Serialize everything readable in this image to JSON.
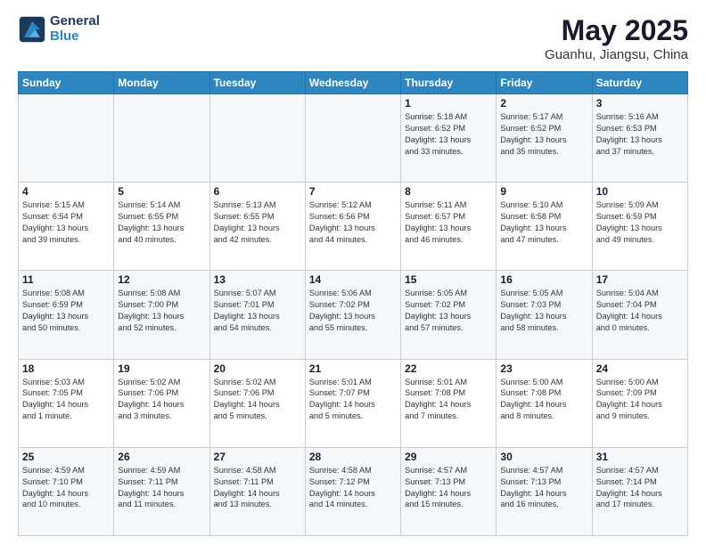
{
  "logo": {
    "line1": "General",
    "line2": "Blue"
  },
  "title": "May 2025",
  "subtitle": "Guanhu, Jiangsu, China",
  "weekdays": [
    "Sunday",
    "Monday",
    "Tuesday",
    "Wednesday",
    "Thursday",
    "Friday",
    "Saturday"
  ],
  "weeks": [
    [
      {
        "day": "",
        "info": ""
      },
      {
        "day": "",
        "info": ""
      },
      {
        "day": "",
        "info": ""
      },
      {
        "day": "",
        "info": ""
      },
      {
        "day": "1",
        "info": "Sunrise: 5:18 AM\nSunset: 6:52 PM\nDaylight: 13 hours\nand 33 minutes."
      },
      {
        "day": "2",
        "info": "Sunrise: 5:17 AM\nSunset: 6:52 PM\nDaylight: 13 hours\nand 35 minutes."
      },
      {
        "day": "3",
        "info": "Sunrise: 5:16 AM\nSunset: 6:53 PM\nDaylight: 13 hours\nand 37 minutes."
      }
    ],
    [
      {
        "day": "4",
        "info": "Sunrise: 5:15 AM\nSunset: 6:54 PM\nDaylight: 13 hours\nand 39 minutes."
      },
      {
        "day": "5",
        "info": "Sunrise: 5:14 AM\nSunset: 6:55 PM\nDaylight: 13 hours\nand 40 minutes."
      },
      {
        "day": "6",
        "info": "Sunrise: 5:13 AM\nSunset: 6:55 PM\nDaylight: 13 hours\nand 42 minutes."
      },
      {
        "day": "7",
        "info": "Sunrise: 5:12 AM\nSunset: 6:56 PM\nDaylight: 13 hours\nand 44 minutes."
      },
      {
        "day": "8",
        "info": "Sunrise: 5:11 AM\nSunset: 6:57 PM\nDaylight: 13 hours\nand 46 minutes."
      },
      {
        "day": "9",
        "info": "Sunrise: 5:10 AM\nSunset: 6:58 PM\nDaylight: 13 hours\nand 47 minutes."
      },
      {
        "day": "10",
        "info": "Sunrise: 5:09 AM\nSunset: 6:59 PM\nDaylight: 13 hours\nand 49 minutes."
      }
    ],
    [
      {
        "day": "11",
        "info": "Sunrise: 5:08 AM\nSunset: 6:59 PM\nDaylight: 13 hours\nand 50 minutes."
      },
      {
        "day": "12",
        "info": "Sunrise: 5:08 AM\nSunset: 7:00 PM\nDaylight: 13 hours\nand 52 minutes."
      },
      {
        "day": "13",
        "info": "Sunrise: 5:07 AM\nSunset: 7:01 PM\nDaylight: 13 hours\nand 54 minutes."
      },
      {
        "day": "14",
        "info": "Sunrise: 5:06 AM\nSunset: 7:02 PM\nDaylight: 13 hours\nand 55 minutes."
      },
      {
        "day": "15",
        "info": "Sunrise: 5:05 AM\nSunset: 7:02 PM\nDaylight: 13 hours\nand 57 minutes."
      },
      {
        "day": "16",
        "info": "Sunrise: 5:05 AM\nSunset: 7:03 PM\nDaylight: 13 hours\nand 58 minutes."
      },
      {
        "day": "17",
        "info": "Sunrise: 5:04 AM\nSunset: 7:04 PM\nDaylight: 14 hours\nand 0 minutes."
      }
    ],
    [
      {
        "day": "18",
        "info": "Sunrise: 5:03 AM\nSunset: 7:05 PM\nDaylight: 14 hours\nand 1 minute."
      },
      {
        "day": "19",
        "info": "Sunrise: 5:02 AM\nSunset: 7:06 PM\nDaylight: 14 hours\nand 3 minutes."
      },
      {
        "day": "20",
        "info": "Sunrise: 5:02 AM\nSunset: 7:06 PM\nDaylight: 14 hours\nand 5 minutes."
      },
      {
        "day": "21",
        "info": "Sunrise: 5:01 AM\nSunset: 7:07 PM\nDaylight: 14 hours\nand 5 minutes."
      },
      {
        "day": "22",
        "info": "Sunrise: 5:01 AM\nSunset: 7:08 PM\nDaylight: 14 hours\nand 7 minutes."
      },
      {
        "day": "23",
        "info": "Sunrise: 5:00 AM\nSunset: 7:08 PM\nDaylight: 14 hours\nand 8 minutes."
      },
      {
        "day": "24",
        "info": "Sunrise: 5:00 AM\nSunset: 7:09 PM\nDaylight: 14 hours\nand 9 minutes."
      }
    ],
    [
      {
        "day": "25",
        "info": "Sunrise: 4:59 AM\nSunset: 7:10 PM\nDaylight: 14 hours\nand 10 minutes."
      },
      {
        "day": "26",
        "info": "Sunrise: 4:59 AM\nSunset: 7:11 PM\nDaylight: 14 hours\nand 11 minutes."
      },
      {
        "day": "27",
        "info": "Sunrise: 4:58 AM\nSunset: 7:11 PM\nDaylight: 14 hours\nand 13 minutes."
      },
      {
        "day": "28",
        "info": "Sunrise: 4:58 AM\nSunset: 7:12 PM\nDaylight: 14 hours\nand 14 minutes."
      },
      {
        "day": "29",
        "info": "Sunrise: 4:57 AM\nSunset: 7:13 PM\nDaylight: 14 hours\nand 15 minutes."
      },
      {
        "day": "30",
        "info": "Sunrise: 4:57 AM\nSunset: 7:13 PM\nDaylight: 14 hours\nand 16 minutes."
      },
      {
        "day": "31",
        "info": "Sunrise: 4:57 AM\nSunset: 7:14 PM\nDaylight: 14 hours\nand 17 minutes."
      }
    ]
  ]
}
